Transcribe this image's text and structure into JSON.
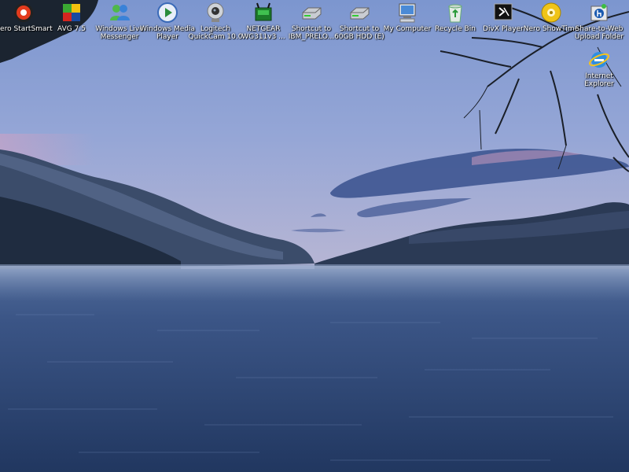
{
  "desktop": {
    "icons": [
      {
        "id": "nero-startsmart",
        "label": "Nero StartSmart",
        "icon": "nero-startsmart-icon"
      },
      {
        "id": "avg",
        "label": "AVG 7.5",
        "icon": "avg-icon"
      },
      {
        "id": "windows-live-messenger",
        "label": "Windows Live Messenger",
        "icon": "messenger-icon"
      },
      {
        "id": "windows-media-player",
        "label": "Windows Media Player",
        "icon": "media-player-icon"
      },
      {
        "id": "logitech-quickcam",
        "label": "Logitech QuickCam 10.0",
        "icon": "webcam-icon"
      },
      {
        "id": "netgear",
        "label": "NETGEAR WG311v3 ...",
        "icon": "netgear-icon"
      },
      {
        "id": "shortcut-ibm",
        "label": "Shortcut to IBM_PRELO...",
        "icon": "drive-icon"
      },
      {
        "id": "shortcut-60gb",
        "label": "Shortcut to 60GB HDD (E)",
        "icon": "drive-icon"
      },
      {
        "id": "my-computer",
        "label": "My Computer",
        "icon": "computer-icon"
      },
      {
        "id": "recycle-bin",
        "label": "Recycle Bin",
        "icon": "recycle-bin-icon"
      },
      {
        "id": "divx-player",
        "label": "DivX Player",
        "icon": "divx-icon"
      },
      {
        "id": "nero-showtime",
        "label": "Nero ShowTime",
        "icon": "nero-showtime-icon"
      },
      {
        "id": "share-to-web",
        "label": "Share-to-Web Upload Folder",
        "icon": "hp-icon"
      },
      {
        "id": "internet-explorer",
        "label": "Internet Explorer",
        "icon": "internet-explorer-icon"
      }
    ]
  },
  "colors": {
    "sky_top": "#7f9ad2",
    "sky_bottom": "#b4b6d6",
    "water": "#2e4873",
    "mountain": "#2a3a52",
    "cloud": "#3e5490",
    "label_text": "#ffffff"
  }
}
